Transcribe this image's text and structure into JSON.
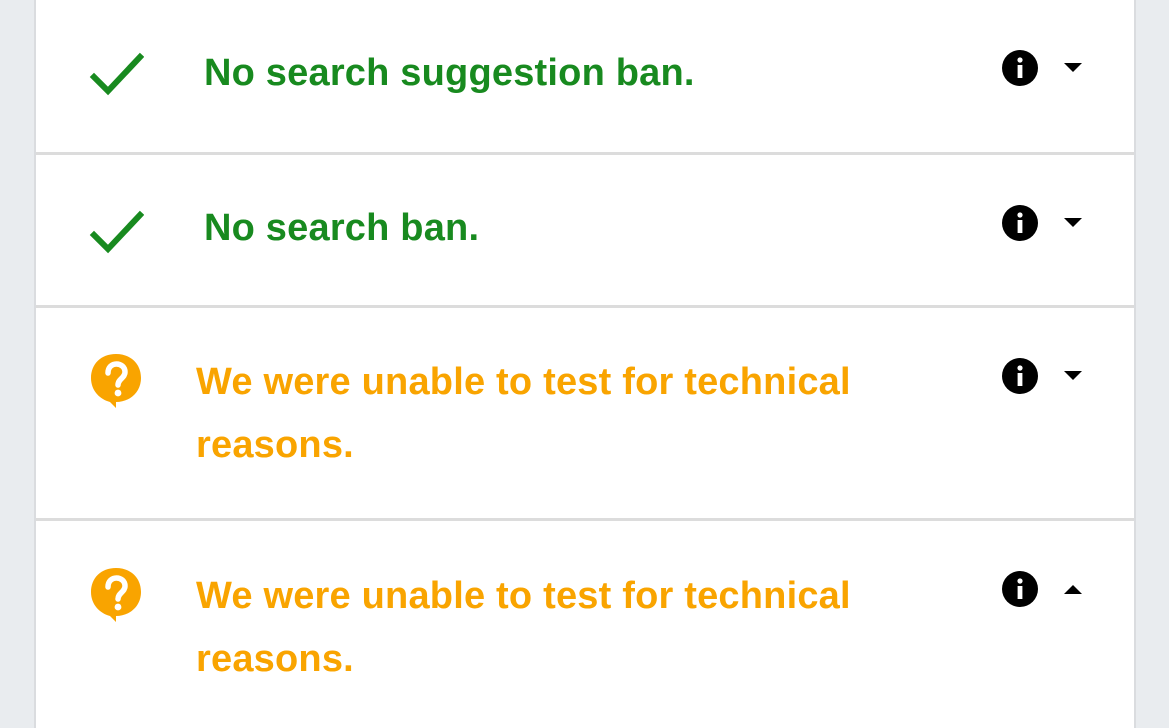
{
  "results": [
    {
      "status": "ok",
      "icon": "checkmark-icon",
      "text": "No search suggestion ban.",
      "info_icon": "info-icon",
      "toggle_icon": "caret-down-icon"
    },
    {
      "status": "ok",
      "icon": "checkmark-icon",
      "text": "No search ban.",
      "info_icon": "info-icon",
      "toggle_icon": "caret-down-icon"
    },
    {
      "status": "unknown",
      "icon": "question-bubble-icon",
      "text": "We were unable to test for technical reasons.",
      "info_icon": "info-icon",
      "toggle_icon": "caret-down-icon"
    },
    {
      "status": "unknown",
      "icon": "question-bubble-icon",
      "text": "We were unable to test for technical reasons.",
      "info_icon": "info-icon",
      "toggle_icon": "caret-up-icon"
    }
  ],
  "colors": {
    "ok": "#188a1f",
    "unknown": "#f9a400",
    "background": "#e9ecef",
    "panel": "#ffffff",
    "divider": "#dcdcdc"
  }
}
